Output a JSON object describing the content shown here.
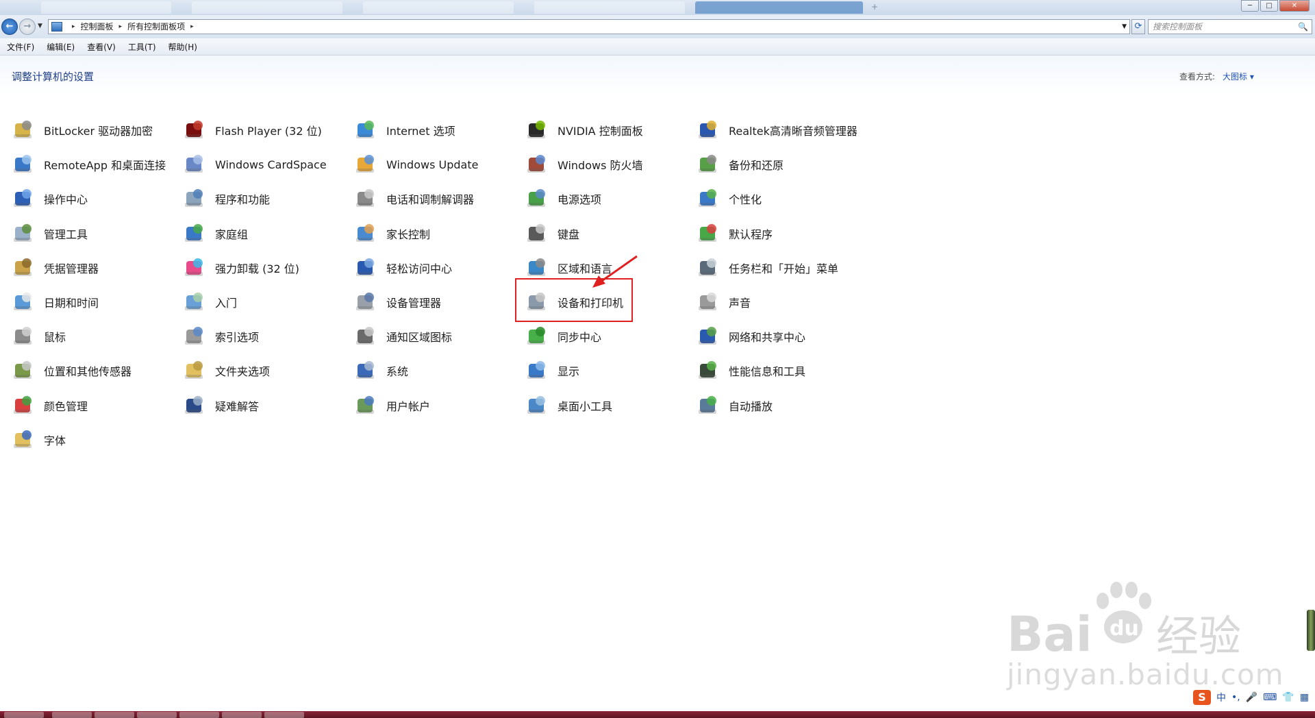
{
  "window": {
    "tab_glyph": "+",
    "minimize_glyph": "─",
    "maximize_glyph": "□",
    "close_glyph": "✕"
  },
  "address": {
    "back_glyph": "←",
    "forward_glyph": "→",
    "dropdown_glyph": "▼",
    "crumbs": [
      "控制面板",
      "所有控制面板项"
    ],
    "crumb_sep": "▸",
    "refresh_glyph": "⟳",
    "search_placeholder": "搜索控制面板",
    "search_icon": "🔍"
  },
  "menu": [
    "文件(F)",
    "编辑(E)",
    "查看(V)",
    "工具(T)",
    "帮助(H)"
  ],
  "header": {
    "title": "调整计算机的设置",
    "view_by_label": "查看方式:",
    "view_by_value": "大图标 ▾"
  },
  "items": [
    {
      "label": "BitLocker 驱动器加密",
      "icon": "bitlocker-icon",
      "c1": "#d6b44a",
      "c2": "#8a8a8a"
    },
    {
      "label": "RemoteApp 和桌面连接",
      "icon": "remoteapp-icon",
      "c1": "#3a78c8",
      "c2": "#9bc3ec"
    },
    {
      "label": "操作中心",
      "icon": "action-center-flag-icon",
      "c1": "#2d5fb6",
      "c2": "#6ea4e6"
    },
    {
      "label": "管理工具",
      "icon": "admin-tools-icon",
      "c1": "#9ab1c9",
      "c2": "#5d8d3c"
    },
    {
      "label": "凭据管理器",
      "icon": "credential-vault-icon",
      "c1": "#c9a24a",
      "c2": "#8a6a2a"
    },
    {
      "label": "日期和时间",
      "icon": "calendar-clock-icon",
      "c1": "#5a9ad8",
      "c2": "#e8e8e8"
    },
    {
      "label": "鼠标",
      "icon": "mouse-icon",
      "c1": "#8c8c8c",
      "c2": "#d0d0d0"
    },
    {
      "label": "位置和其他传感器",
      "icon": "sensor-icon",
      "c1": "#7a9a4a",
      "c2": "#c7c7c7"
    },
    {
      "label": "颜色管理",
      "icon": "color-management-icon",
      "c1": "#d84040",
      "c2": "#40a040"
    },
    {
      "label": "字体",
      "icon": "fonts-folder-icon",
      "c1": "#e2c060",
      "c2": "#3a6ac0"
    },
    {
      "label": "Flash Player (32 位)",
      "icon": "flash-player-icon",
      "c1": "#7a0e0e",
      "c2": "#c23a2a"
    },
    {
      "label": "Windows CardSpace",
      "icon": "cardspace-icon",
      "c1": "#6a88c8",
      "c2": "#a8c0e8"
    },
    {
      "label": "程序和功能",
      "icon": "programs-features-icon",
      "c1": "#8ca4bc",
      "c2": "#4f7fb8"
    },
    {
      "label": "家庭组",
      "icon": "homegroup-icon",
      "c1": "#3a78c8",
      "c2": "#48a848"
    },
    {
      "label": "强力卸载 (32 位)",
      "icon": "uninstaller-icon",
      "c1": "#e84a8a",
      "c2": "#3ab8e8"
    },
    {
      "label": "入门",
      "icon": "getting-started-icon",
      "c1": "#6aa0d8",
      "c2": "#a8d0a8"
    },
    {
      "label": "索引选项",
      "icon": "indexing-magnifier-icon",
      "c1": "#9a9a9a",
      "c2": "#5a88c8"
    },
    {
      "label": "文件夹选项",
      "icon": "folder-options-icon",
      "c1": "#e2c060",
      "c2": "#b89a40"
    },
    {
      "label": "疑难解答",
      "icon": "troubleshoot-icon",
      "c1": "#2a4a8a",
      "c2": "#9ab0c8"
    },
    {
      "label": "Internet 选项",
      "icon": "internet-options-icon",
      "c1": "#3a8ad8",
      "c2": "#58b858"
    },
    {
      "label": "Windows Update",
      "icon": "windows-update-icon",
      "c1": "#e8a838",
      "c2": "#5890d8"
    },
    {
      "label": "电话和调制解调器",
      "icon": "phone-modem-icon",
      "c1": "#8a8a8a",
      "c2": "#c8c8c8"
    },
    {
      "label": "家长控制",
      "icon": "parental-controls-icon",
      "c1": "#4a8ad0",
      "c2": "#e0a050"
    },
    {
      "label": "轻松访问中心",
      "icon": "ease-of-access-icon",
      "c1": "#2a5ab0",
      "c2": "#7aa8e0"
    },
    {
      "label": "设备管理器",
      "icon": "device-manager-icon",
      "c1": "#9aa0aa",
      "c2": "#5878a8"
    },
    {
      "label": "通知区域图标",
      "icon": "notification-area-icon",
      "c1": "#6a6a6a",
      "c2": "#c8c8c8"
    },
    {
      "label": "系统",
      "icon": "system-icon",
      "c1": "#3a6ab8",
      "c2": "#a8b8d0"
    },
    {
      "label": "用户帐户",
      "icon": "user-accounts-icon",
      "c1": "#6a9a5a",
      "c2": "#4a7ac0"
    },
    {
      "label": "NVIDIA 控制面板",
      "icon": "nvidia-icon",
      "c1": "#2a2a2a",
      "c2": "#76b900"
    },
    {
      "label": "Windows 防火墙",
      "icon": "firewall-icon",
      "c1": "#a04a3a",
      "c2": "#5a88d0"
    },
    {
      "label": "电源选项",
      "icon": "power-options-icon",
      "c1": "#48a048",
      "c2": "#5a88c8"
    },
    {
      "label": "键盘",
      "icon": "keyboard-icon",
      "c1": "#5a5a5a",
      "c2": "#c8c8c8"
    },
    {
      "label": "区域和语言",
      "icon": "region-language-icon",
      "c1": "#3a88c8",
      "c2": "#8a8a8a"
    },
    {
      "label": "设备和打印机",
      "icon": "devices-printers-icon",
      "c1": "#8a9aaa",
      "c2": "#c8c8c8"
    },
    {
      "label": "同步中心",
      "icon": "sync-center-icon",
      "c1": "#48b048",
      "c2": "#2a8a2a"
    },
    {
      "label": "显示",
      "icon": "display-icon",
      "c1": "#3a78c8",
      "c2": "#8ab8e8"
    },
    {
      "label": "桌面小工具",
      "icon": "desktop-gadgets-icon",
      "c1": "#4a88c8",
      "c2": "#9ac0e0"
    },
    {
      "label": "Realtek高清晰音频管理器",
      "icon": "realtek-audio-icon",
      "c1": "#2a58b0",
      "c2": "#e0b030"
    },
    {
      "label": "备份和还原",
      "icon": "backup-restore-icon",
      "c1": "#58a048",
      "c2": "#8a8a8a"
    },
    {
      "label": "个性化",
      "icon": "personalization-icon",
      "c1": "#3a78c8",
      "c2": "#58b048"
    },
    {
      "label": "默认程序",
      "icon": "default-programs-icon",
      "c1": "#48a848",
      "c2": "#d84040"
    },
    {
      "label": "任务栏和「开始」菜单",
      "icon": "taskbar-start-icon",
      "c1": "#5a6a7a",
      "c2": "#c8d0d8"
    },
    {
      "label": "声音",
      "icon": "sound-speaker-icon",
      "c1": "#9a9a9a",
      "c2": "#d8d8d8"
    },
    {
      "label": "网络和共享中心",
      "icon": "network-sharing-icon",
      "c1": "#2a5ab0",
      "c2": "#58a048"
    },
    {
      "label": "性能信息和工具",
      "icon": "performance-icon",
      "c1": "#3a4a3a",
      "c2": "#58b048"
    },
    {
      "label": "自动播放",
      "icon": "autoplay-icon",
      "c1": "#5a7a9a",
      "c2": "#48b048"
    }
  ],
  "watermark": {
    "logo": "Bai du 经验",
    "url": "jingyan.baidu.com"
  },
  "ime": {
    "logo": "S",
    "mode": "中",
    "punct": "•,",
    "mic": "🎤",
    "keyboard": "⌨",
    "skin": "👕",
    "grid": "▦"
  },
  "colors": {
    "title_blue": "#1e3f88",
    "highlight_red": "#e02020",
    "link_blue": "#1e50b3"
  }
}
